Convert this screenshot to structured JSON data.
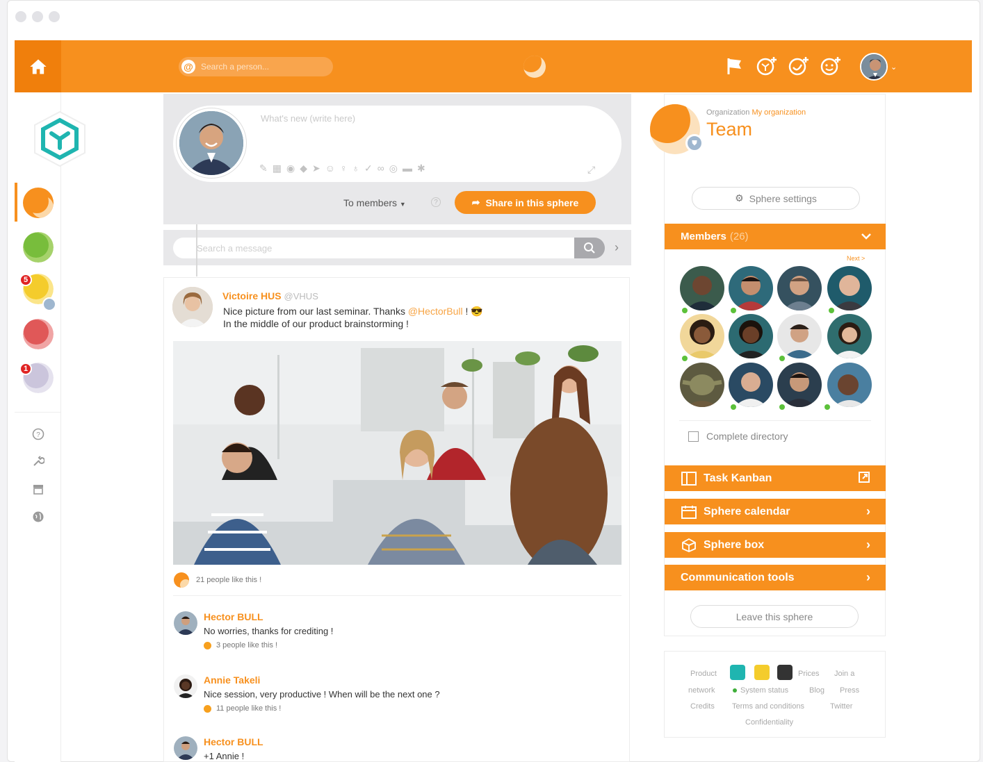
{
  "topbar": {
    "search_placeholder": "Search a person...",
    "icons": [
      "home-icon",
      "flag-icon",
      "add-sphere-icon",
      "add-event-icon",
      "add-contact-icon"
    ],
    "accent": "#f7901e"
  },
  "composer": {
    "placeholder": "What's new (write here)",
    "audience": "To members",
    "share_label": "Share in this sphere"
  },
  "message_search": {
    "placeholder": "Search a message"
  },
  "post": {
    "author": "Victoire HUS",
    "handle": "@VHUS",
    "text_before": "Nice picture from our last seminar. Thanks",
    "mention": "@HectorBull",
    "text_after": "! 😎",
    "line2": "In the middle of our product brainstorming !",
    "likes": "21 people like this !"
  },
  "comments": [
    {
      "author": "Hector BULL",
      "text": "No worries, thanks for crediting !",
      "likes": "3 people like this !"
    },
    {
      "author": "Annie Takeli",
      "text": "Nice session, very productive ! When will be the next one ?",
      "likes": "11 people like this !"
    },
    {
      "author": "Hector BULL",
      "text": "+1 Annie !"
    }
  ],
  "sidebar": {
    "badges": [
      "5",
      "1"
    ]
  },
  "sphere": {
    "org_label": "Organization",
    "org_name": "My organization",
    "name": "Team",
    "settings_label": "Sphere settings",
    "members_label": "Members",
    "members_count": "(26)",
    "next_label": "Next >",
    "directory_label": "Complete directory",
    "task_kanban": "Task Kanban",
    "calendar": "Sphere calendar",
    "box": "Sphere box",
    "communication": "Communication tools",
    "leave": "Leave this sphere"
  },
  "footer": {
    "product": "Product",
    "prices": "Prices",
    "join": "Join a",
    "network": "network",
    "system_status": "System status",
    "blog": "Blog",
    "press": "Press",
    "credits": "Credits",
    "terms": "Terms and conditions",
    "twitter": "Twitter",
    "confidentiality": "Confidentiality"
  }
}
